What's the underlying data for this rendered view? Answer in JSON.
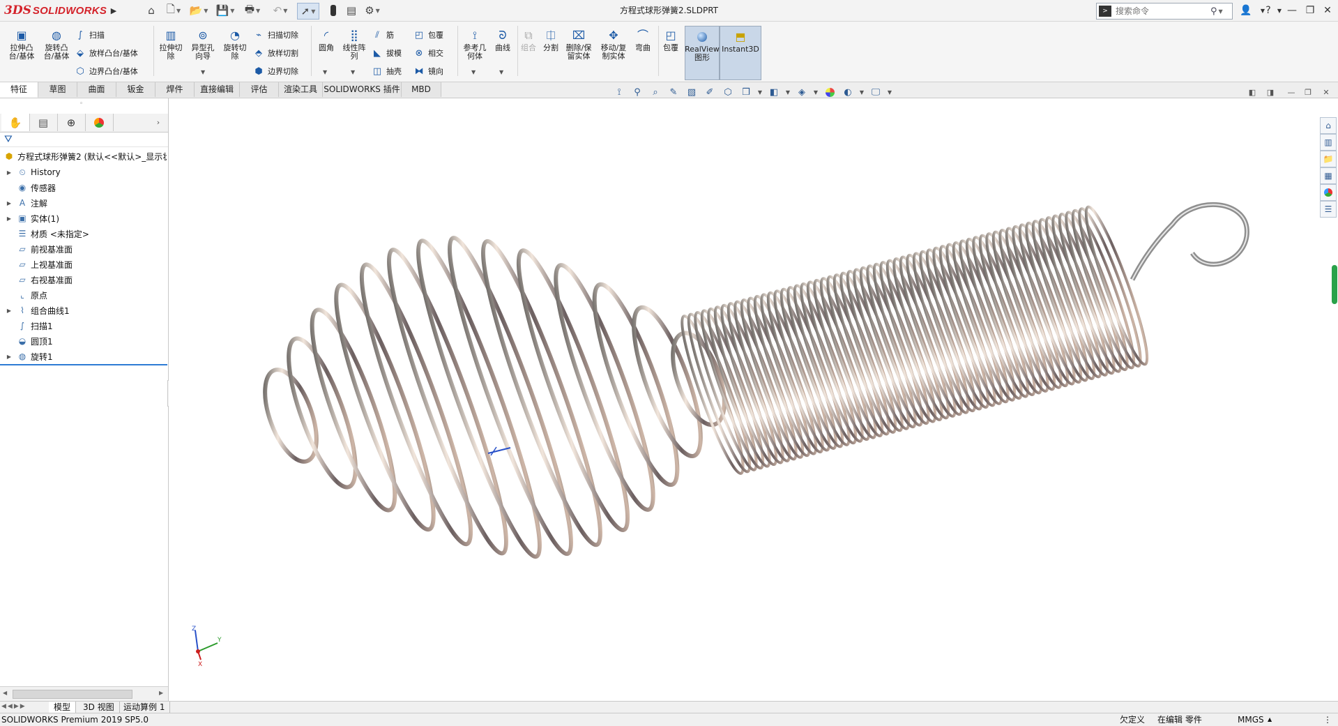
{
  "app": {
    "brand_prefix": "3DS",
    "brand": "SOLIDWORKS"
  },
  "window": {
    "title": "方程式球形弹簧2.SLDPRT"
  },
  "search": {
    "placeholder": "搜索命令"
  },
  "command_manager": {
    "extrude_boss": "拉伸凸\n台/基体",
    "revolve_boss": "旋转凸\n台/基体",
    "sweep": "扫描",
    "loft_boss": "放样凸台/基体",
    "boundary_boss": "边界凸台/基体",
    "extrude_cut": "拉伸切\n除",
    "hole_wizard": "异型孔\n向导",
    "revolve_cut": "旋转切\n除",
    "swept_cut": "扫描切除",
    "lofted_cut": "放样切割",
    "boundary_cut": "边界切除",
    "fillet": "圆角",
    "linear_pattern": "线性阵\n列",
    "rib": "筋",
    "draft": "拔模",
    "shell": "抽壳",
    "wrap": "包覆",
    "intersect": "相交",
    "mirror": "镜向",
    "reference_geometry": "参考几\n何体",
    "curves": "曲线",
    "combine": "组合",
    "split": "分割",
    "delete_keep_body": "删除/保\n留实体",
    "move_copy_body": "移动/复\n制实体",
    "flex": "弯曲",
    "wrap2": "包覆",
    "realview": "RealView\n图形",
    "instant3d": "Instant3D"
  },
  "tabs": [
    "特征",
    "草图",
    "曲面",
    "钣金",
    "焊件",
    "直接编辑",
    "评估",
    "渲染工具",
    "SOLIDWORKS 插件",
    "MBD"
  ],
  "feature_tree": {
    "root": "方程式球形弹簧2 (默认<<默认>_显示状",
    "items": [
      {
        "label": "History",
        "icon": "history-icon",
        "expandable": true
      },
      {
        "label": "传感器",
        "icon": "sensor-icon",
        "expandable": false
      },
      {
        "label": "注解",
        "icon": "annotation-icon",
        "expandable": true
      },
      {
        "label": "实体(1)",
        "icon": "solid-bodies-icon",
        "expandable": true
      },
      {
        "label": "材质 <未指定>",
        "icon": "material-icon",
        "expandable": false
      },
      {
        "label": "前视基准面",
        "icon": "plane-icon",
        "expandable": false
      },
      {
        "label": "上视基准面",
        "icon": "plane-icon",
        "expandable": false
      },
      {
        "label": "右视基准面",
        "icon": "plane-icon",
        "expandable": false
      },
      {
        "label": "原点",
        "icon": "origin-icon",
        "expandable": false
      },
      {
        "label": "组合曲线1",
        "icon": "composite-curve-icon",
        "expandable": true
      },
      {
        "label": "扫描1",
        "icon": "sweep-icon",
        "expandable": false
      },
      {
        "label": "圆顶1",
        "icon": "dome-icon",
        "expandable": false
      },
      {
        "label": "旋转1",
        "icon": "revolve-icon",
        "expandable": true
      }
    ]
  },
  "bottom_tabs": [
    "模型",
    "3D 视图",
    "运动算例 1"
  ],
  "status": {
    "product": "SOLIDWORKS Premium 2019 SP5.0",
    "definition": "欠定义",
    "editing": "在编辑 零件",
    "units": "MMGS"
  },
  "triad": {
    "x": "X",
    "y": "Y",
    "z": "Z"
  },
  "colors": {
    "brand_red": "#d4222a",
    "accent_blue": "#1c5aa6"
  }
}
